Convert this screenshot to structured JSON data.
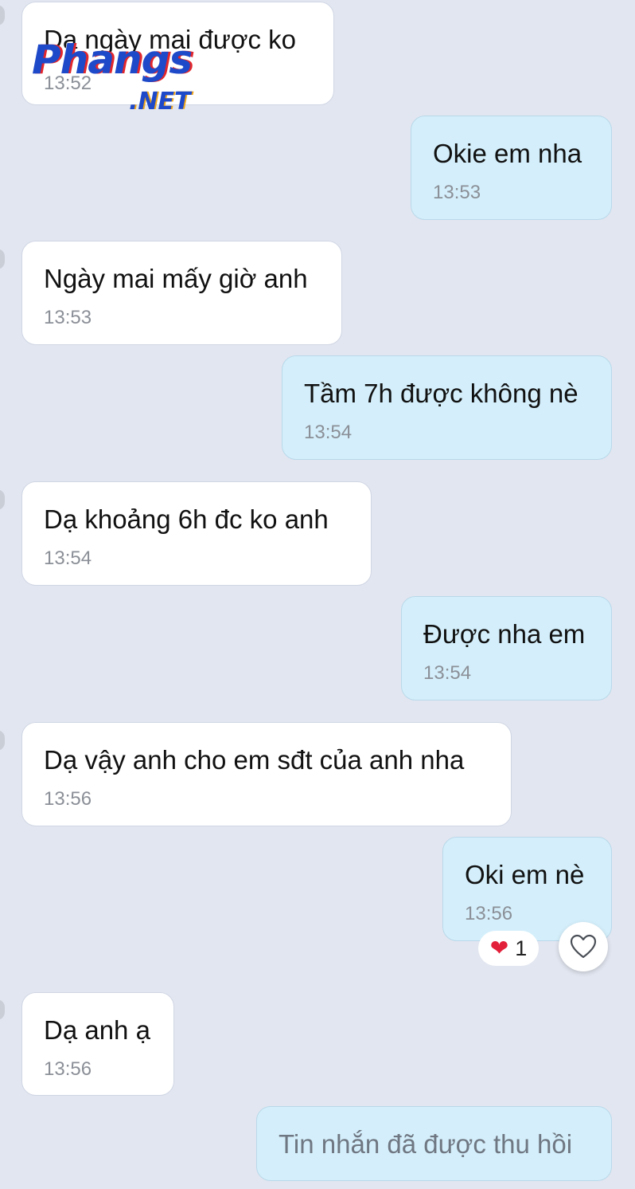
{
  "messages": [
    {
      "side": "in",
      "text": "Dạ ngày mai được ko",
      "time": "13:52"
    },
    {
      "side": "out",
      "text": "Okie em nha",
      "time": "13:53"
    },
    {
      "side": "in",
      "text": "Ngày mai mấy giờ anh",
      "time": "13:53"
    },
    {
      "side": "out",
      "text": "Tầm 7h được không nè",
      "time": "13:54"
    },
    {
      "side": "in",
      "text": "Dạ khoảng 6h đc ko anh",
      "time": "13:54"
    },
    {
      "side": "out",
      "text": "Được nha em",
      "time": "13:54"
    },
    {
      "side": "in",
      "text": "Dạ vậy anh cho em sđt của anh nha",
      "time": "13:56"
    },
    {
      "side": "out",
      "text": "Oki em nè",
      "time": "13:56"
    },
    {
      "side": "in",
      "text": "Dạ anh ạ",
      "time": "13:56"
    },
    {
      "side": "out",
      "text": "Tin nhắn đã được thu hồi"
    }
  ],
  "reaction": {
    "icon": "heart-icon",
    "count": "1",
    "color": "#e3203a"
  },
  "like_button": {
    "icon": "heart-outline-icon"
  },
  "watermark": {
    "main": "Phangs",
    "sub": ".NET"
  },
  "colors": {
    "background": "#e2e6f0",
    "incoming": "#ffffff",
    "outgoing": "#d4effb"
  }
}
